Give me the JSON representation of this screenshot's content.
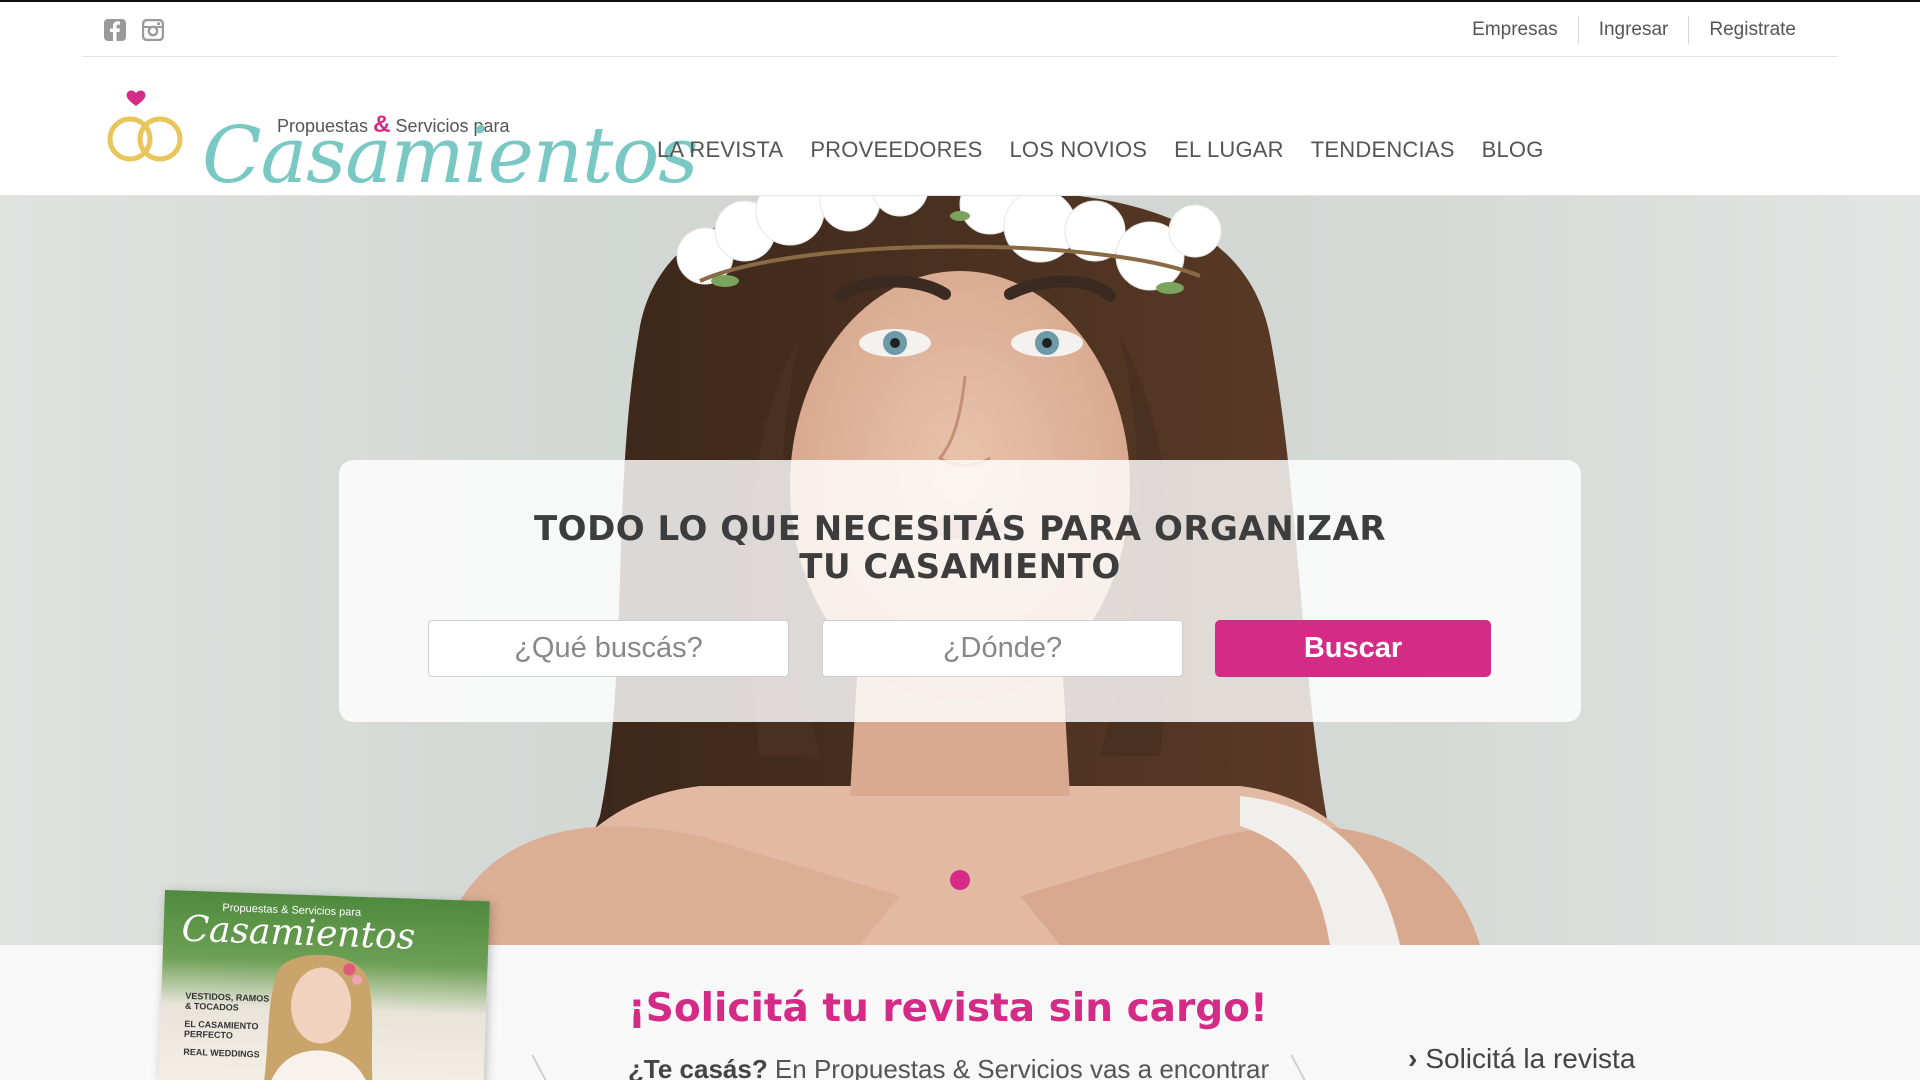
{
  "topbar": {
    "social": [
      {
        "icon": "facebook-icon"
      },
      {
        "icon": "instagram-icon"
      }
    ],
    "links": [
      {
        "label": "Empresas"
      },
      {
        "label": "Ingresar"
      },
      {
        "label": "Registrate"
      }
    ]
  },
  "logo": {
    "subtitle_pre": "Propuestas",
    "subtitle_amp": "&",
    "subtitle_post": "Servicios para",
    "title": "Casamientos"
  },
  "nav": [
    {
      "label": "LA REVISTA"
    },
    {
      "label": "PROVEEDORES"
    },
    {
      "label": "LOS NOVIOS"
    },
    {
      "label": "EL LUGAR"
    },
    {
      "label": "TENDENCIAS"
    },
    {
      "label": "BLOG"
    }
  ],
  "hero": {
    "title": "TODO LO QUE NECESITÁS PARA ORGANIZAR TU CASAMIENTO",
    "what_placeholder": "¿Qué buscás?",
    "where_placeholder": "¿Dónde?",
    "search_label": "Buscar"
  },
  "promo": {
    "magazine": {
      "subtitle": "Propuestas & Servicios para",
      "title": "Casamientos",
      "lines": [
        "VESTIDOS, RAMOS & TOCADOS",
        "EL CASAMIENTO PERFECTO",
        "REAL WEDDINGS"
      ]
    },
    "title": "¡Solicitá tu revista sin cargo!",
    "text_bold": "¿Te casás?",
    "text_rest": " En Propuestas & Servicios vas a encontrar",
    "link_label": "Solicitá la revista"
  },
  "colors": {
    "accent": "#d42b87",
    "logo_teal": "#79c8c4",
    "ring_gold": "#e8c65a"
  }
}
